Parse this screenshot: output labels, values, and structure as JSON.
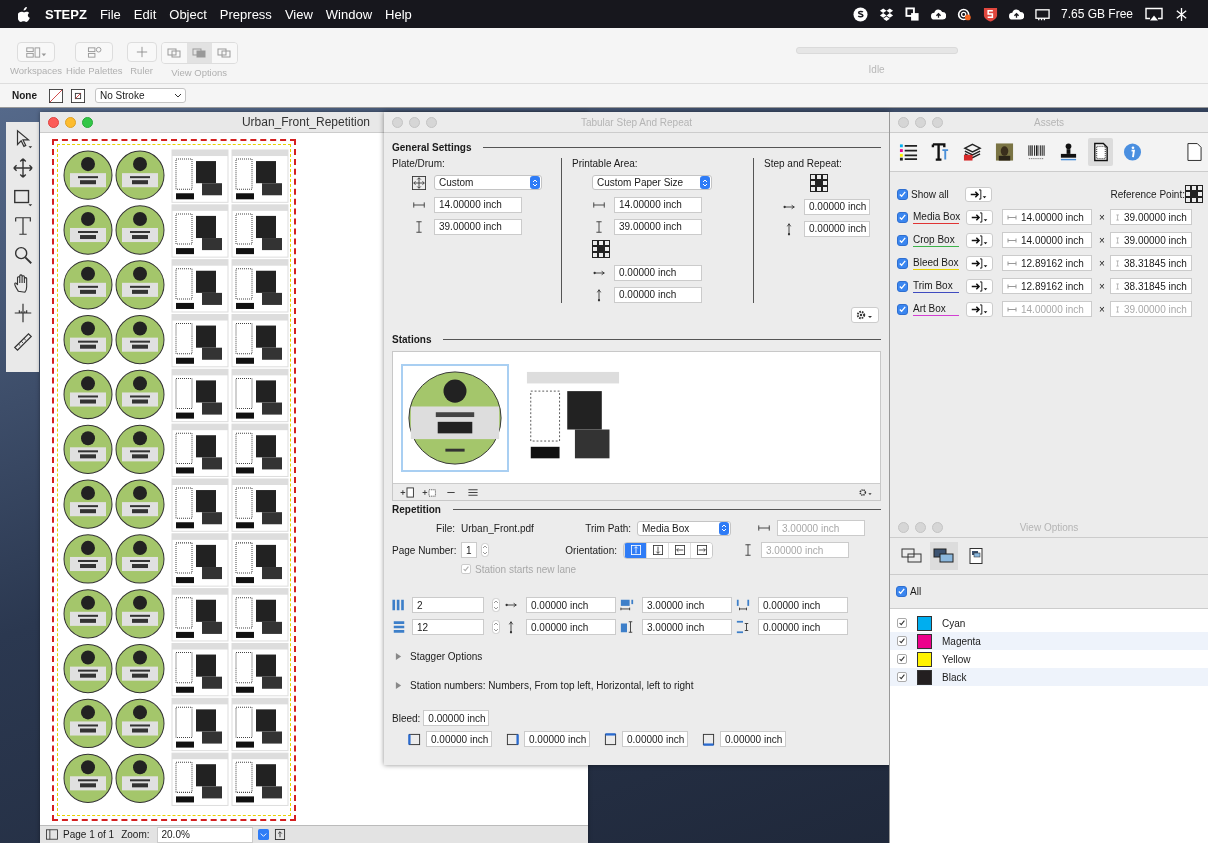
{
  "menu_bar": {
    "app": "STEPZ",
    "items": [
      "File",
      "Edit",
      "Object",
      "Prepress",
      "View",
      "Window",
      "Help"
    ],
    "disk_free": "7.65 GB Free"
  },
  "toolbar": {
    "buttons": [
      "Workspaces",
      "Hide Palettes",
      "Ruler"
    ],
    "view_options": {
      "label": "View Options",
      "segments": [
        {
          "selected": false
        },
        {
          "selected": true
        },
        {
          "selected": false
        }
      ]
    },
    "progress": {
      "level": 0,
      "label": "Idle"
    }
  },
  "stroke_bar": {
    "fill": "None",
    "stroke": "No Stroke"
  },
  "document": {
    "title": "Urban_Front_Repetition",
    "page": "Page 1 of 1",
    "zoom_label": "Zoom:",
    "zoom": "20.0%"
  },
  "dialog": {
    "title": "Tabular Step And Repeat",
    "general_heading": "General Settings",
    "plate_drum": {
      "label": "Plate/Drum:",
      "preset": "Custom",
      "width": "14.00000 inch",
      "height": "39.00000 inch"
    },
    "printable_area": {
      "label": "Printable Area:",
      "preset": "Custom Paper Size",
      "width": "14.00000 inch",
      "height": "39.00000 inch",
      "offset_x": "0.00000 inch",
      "offset_y": "0.00000 inch"
    },
    "step_and_repeat": {
      "label": "Step and Repeat:",
      "x": "0.00000 inch",
      "y": "0.00000 inch"
    },
    "stations_heading": "Stations",
    "stations": [
      {
        "kind": "round",
        "selected": true
      },
      {
        "kind": "back",
        "selected": false
      }
    ],
    "repetition": {
      "heading": "Repetition",
      "file_label": "File:",
      "file": "Urban_Front.pdf",
      "trim_path_label": "Trim Path:",
      "trim_path": "Media Box",
      "width": "3.00000 inch",
      "height": "3.00000 inch",
      "page_number_label": "Page Number:",
      "page_number": "1",
      "orientation_label": "Orientation:",
      "orientation": [
        {
          "selected": true
        },
        {
          "selected": false
        },
        {
          "selected": false
        },
        {
          "selected": false
        }
      ],
      "new_lane": {
        "label": "Station starts new lane",
        "checked": true,
        "disabled": true
      },
      "columns": "2",
      "rows": "12",
      "h_gap": "0.00000 inch",
      "v_gap": "0.00000 inch",
      "step_width": "3.00000 inch",
      "step_height": "3.00000 inch",
      "h_offset": "0.00000 inch",
      "v_offset": "0.00000 inch",
      "stagger": {
        "label": "Stagger Options",
        "expanded": false
      },
      "station_numbers": {
        "label": "Station numbers: Numbers, From top left, Horizontal, left to right",
        "expanded": false
      },
      "bleed_label": "Bleed:",
      "bleed": "0.00000 inch",
      "bleed_sides": [
        "0.00000 inch",
        "0.00000 inch",
        "0.00000 inch",
        "0.00000 inch"
      ]
    }
  },
  "assets": {
    "title": "Assets",
    "tabs": [
      {
        "kind": "separations",
        "selected": false
      },
      {
        "kind": "text",
        "selected": false
      },
      {
        "kind": "layers",
        "selected": false
      },
      {
        "kind": "image",
        "selected": false
      },
      {
        "kind": "barcode",
        "selected": false
      },
      {
        "kind": "stamp",
        "selected": false
      },
      {
        "kind": "boxes",
        "selected": true
      },
      {
        "kind": "info",
        "selected": false
      }
    ],
    "show_all": {
      "label": "Show all",
      "checked": true
    },
    "reference_label": "Reference Point:",
    "times_sign": "×",
    "boxes": [
      {
        "name": "Media Box",
        "color": "#e03434",
        "checked": true,
        "width": "14.00000 inch",
        "height": "39.00000 inch",
        "disabled": false
      },
      {
        "name": "Crop Box",
        "color": "#3db34a",
        "checked": true,
        "width": "14.00000 inch",
        "height": "39.00000 inch",
        "disabled": false
      },
      {
        "name": "Bleed Box",
        "color": "#e6d200",
        "checked": true,
        "width": "12.89162 inch",
        "height": "38.31845 inch",
        "disabled": false
      },
      {
        "name": "Trim Box",
        "color": "#3f4bbf",
        "checked": true,
        "width": "12.89162 inch",
        "height": "38.31845 inch",
        "disabled": false
      },
      {
        "name": "Art Box",
        "color": "#d23fd2",
        "checked": true,
        "width": "14.00000 inch",
        "height": "39.00000 inch",
        "disabled": true
      }
    ]
  },
  "view_options": {
    "title": "View Options",
    "modes": [
      {
        "kind": "outline",
        "selected": false
      },
      {
        "kind": "filled",
        "selected": true
      },
      {
        "kind": "page",
        "selected": false
      }
    ],
    "all": {
      "label": "All",
      "checked": true
    },
    "separations": [
      {
        "name": "Cyan",
        "color": "#00aeef",
        "checked": true
      },
      {
        "name": "Magenta",
        "color": "#ec008c",
        "checked": true
      },
      {
        "name": "Yellow",
        "color": "#fff200",
        "checked": true
      },
      {
        "name": "Black",
        "color": "#231f20",
        "checked": true
      }
    ]
  }
}
